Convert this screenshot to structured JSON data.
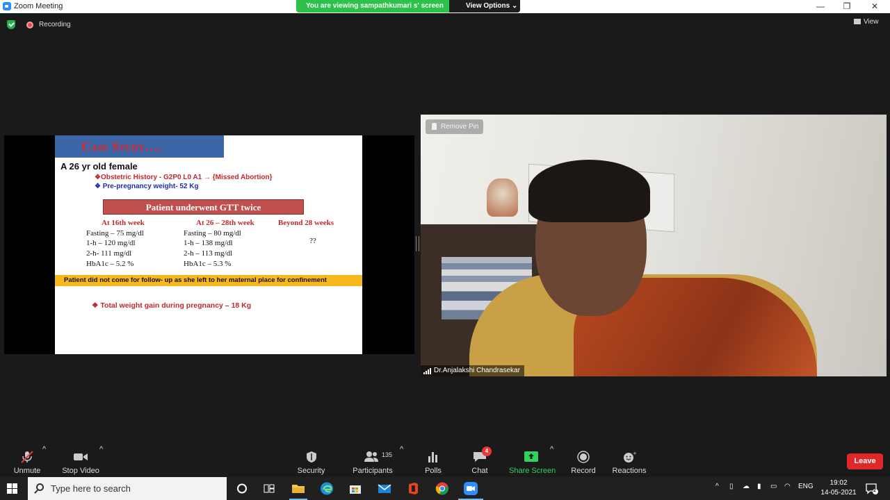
{
  "window": {
    "title": "Zoom Meeting",
    "controls": [
      "—",
      "❐",
      "✕"
    ]
  },
  "banner": {
    "viewing_text": "You are viewing sampathkumari s' screen",
    "view_options": "View Options"
  },
  "status": {
    "recording": "Recording",
    "view": "View"
  },
  "slide": {
    "title": "Case Study….",
    "heading": "A 26 yr old female",
    "bullet1_prefix": "❖Obstetric History - G",
    "bullet1_formula": "2P0 L0 A1",
    "bullet1_suffix": "→ {Missed Abortion}",
    "bullet2": "❖ Pre-pregnancy weight- 52 Kg",
    "gtt_banner": "Patient underwent GTT twice",
    "columns": [
      {
        "head": "At 16th week",
        "rows": [
          "Fasting – 75 mg/dl",
          "1-h – 120 mg/dl",
          "2-h- 111 mg/dl",
          "HbA1c – 5.2 %"
        ]
      },
      {
        "head": "At 26 – 28th week",
        "rows": [
          "Fasting – 80 mg/dl",
          "1-h – 138 mg/dl",
          "2-h – 113 mg/dl",
          "HbA1c – 5.3 %"
        ]
      },
      {
        "head": "Beyond 28 weeks",
        "rows": [
          "??"
        ]
      }
    ],
    "followup": "Patient did not come for follow- up as she left to her maternal place for confinement",
    "weight_gain": "❖ Total weight gain during pregnancy – 18 Kg"
  },
  "video": {
    "remove_pin": "Remove Pin",
    "participant_name": "Dr.Anjalakshi Chandrasekar"
  },
  "toolbar": {
    "unmute": "Unmute",
    "stop_video": "Stop Video",
    "security": "Security",
    "participants": "Participants",
    "participant_count": "135",
    "polls": "Polls",
    "chat": "Chat",
    "chat_badge": "4",
    "share_screen": "Share Screen",
    "record": "Record",
    "reactions": "Reactions",
    "leave": "Leave"
  },
  "taskbar": {
    "search_placeholder": "Type here to search",
    "language": "ENG",
    "time": "19:02",
    "date": "14-05-2021",
    "notification_count": "2"
  },
  "colors": {
    "zoom_blue": "#2d8cff",
    "banner_green": "#2cc24a",
    "leave_red": "#e02828",
    "share_green": "#2fd45c",
    "slide_red": "#c0282d"
  }
}
